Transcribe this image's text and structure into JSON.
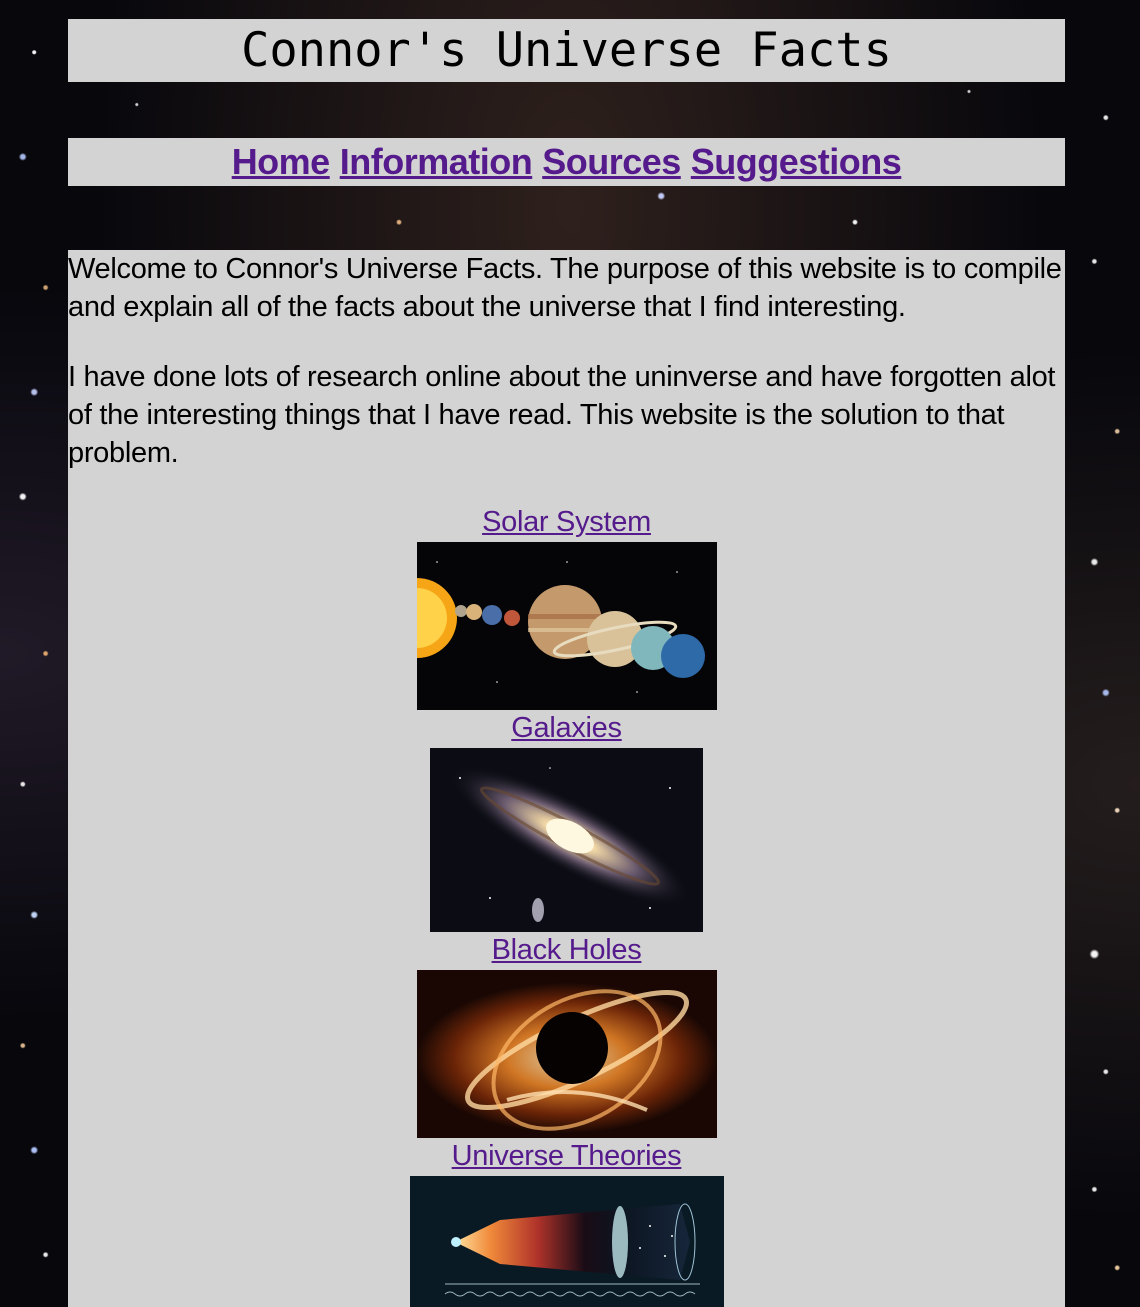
{
  "header": {
    "title": "Connor's Universe Facts"
  },
  "nav": {
    "items": [
      {
        "label": "Home"
      },
      {
        "label": "Information"
      },
      {
        "label": "Sources"
      },
      {
        "label": "Suggestions"
      }
    ]
  },
  "main": {
    "intro_1": "Welcome to Connor's Universe Facts. The purpose of this website is to compile and explain all of the facts about the universe that I find interesting.",
    "intro_2": "I have done lots of research online about the uninverse and have forgotten alot of the interesting things that I have read. This website is the solution to that problem.",
    "topics": [
      {
        "label": "Solar System",
        "image_icon": "solar-system-image"
      },
      {
        "label": "Galaxies",
        "image_icon": "galaxy-image"
      },
      {
        "label": "Black Holes",
        "image_icon": "black-hole-image"
      },
      {
        "label": "Universe Theories",
        "image_icon": "universe-timeline-image"
      }
    ]
  },
  "colors": {
    "panel_bg": "#d3d3d3",
    "link_visited": "#551a8b",
    "text": "#000000"
  }
}
